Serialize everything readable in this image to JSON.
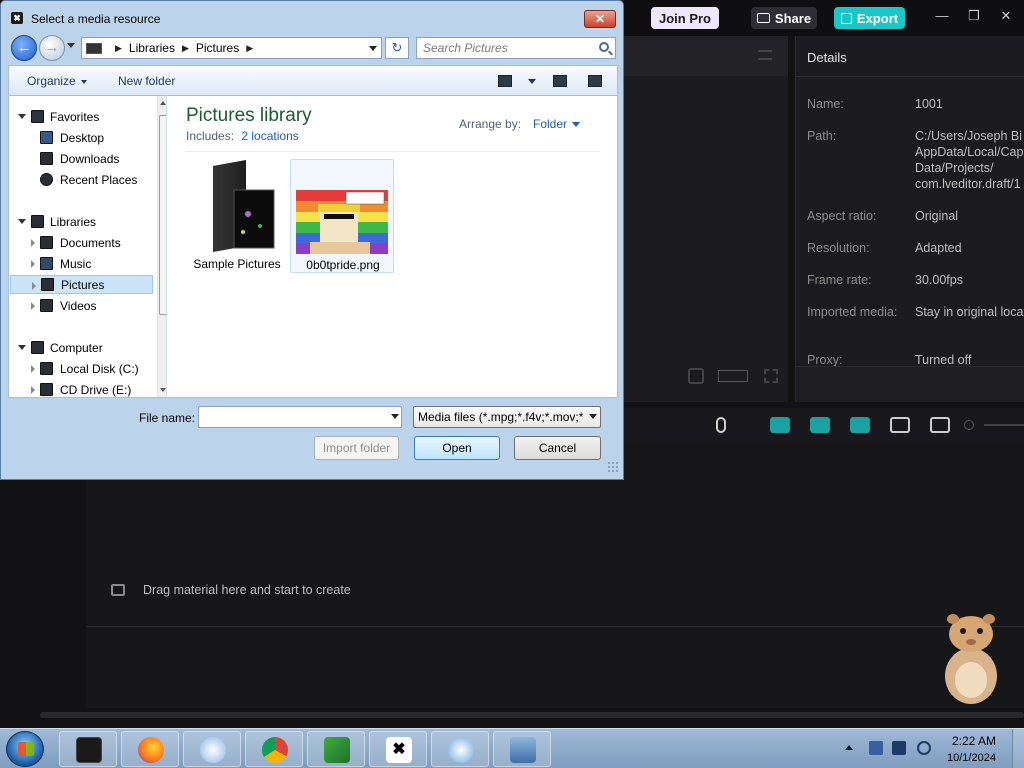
{
  "editor": {
    "join_pro": "Join Pro",
    "share": "Share",
    "export": "Export",
    "details": {
      "title": "Details",
      "rows": [
        {
          "label": "Name:",
          "value": "1001"
        },
        {
          "label": "Path:",
          "value": "C:/Users/Joseph Bi\nAppData/Local/Cap\nData/Projects/\ncom.lveditor.draft/1"
        },
        {
          "label": "Aspect ratio:",
          "value": "Original"
        },
        {
          "label": "Resolution:",
          "value": "Adapted"
        },
        {
          "label": "Frame rate:",
          "value": "30.00fps"
        },
        {
          "label": "Imported media:",
          "value": "Stay in original loca"
        },
        {
          "label": "Proxy:",
          "value": "Turned off"
        }
      ]
    },
    "timeline_hint": "Drag material here and start to create"
  },
  "dialog": {
    "title": "Select a media resource",
    "close": "✕",
    "address": {
      "segments": [
        "Libraries",
        "Pictures"
      ]
    },
    "search_placeholder": "Search Pictures",
    "commands": {
      "organize": "Organize",
      "new_folder": "New folder"
    },
    "nav_tree": [
      {
        "label": "Favorites",
        "level": 0,
        "expanded": true
      },
      {
        "label": "Desktop",
        "level": 1
      },
      {
        "label": "Downloads",
        "level": 1
      },
      {
        "label": "Recent Places",
        "level": 1
      },
      {
        "label": "Libraries",
        "level": 0,
        "expanded": true
      },
      {
        "label": "Documents",
        "level": 1
      },
      {
        "label": "Music",
        "level": 1
      },
      {
        "label": "Pictures",
        "level": 1,
        "selected": true
      },
      {
        "label": "Videos",
        "level": 1
      },
      {
        "label": "Computer",
        "level": 0,
        "expanded": true
      },
      {
        "label": "Local Disk (C:)",
        "level": 1
      },
      {
        "label": "CD Drive (E:)",
        "level": 1
      }
    ],
    "library": {
      "title": "Pictures library",
      "includes_label": "Includes:",
      "includes_link": "2 locations",
      "arrange_label": "Arrange by:",
      "arrange_value": "Folder"
    },
    "files": [
      {
        "name": "Sample Pictures",
        "kind": "folder"
      },
      {
        "name": "0b0tpride.png",
        "kind": "image"
      }
    ],
    "file_name_label": "File name:",
    "file_name_value": "",
    "filter": "Media files (*.mpg;*.f4v;*.mov;*",
    "buttons": {
      "import_folder": "Import folder",
      "open": "Open",
      "cancel": "Cancel"
    }
  },
  "taskbar": {
    "time": "2:22 AM",
    "date": "10/1/2024"
  },
  "colors": {
    "export_accent": "#1bc6c6",
    "library_title": "#1e5b2e",
    "link": "#1f5fb4"
  }
}
